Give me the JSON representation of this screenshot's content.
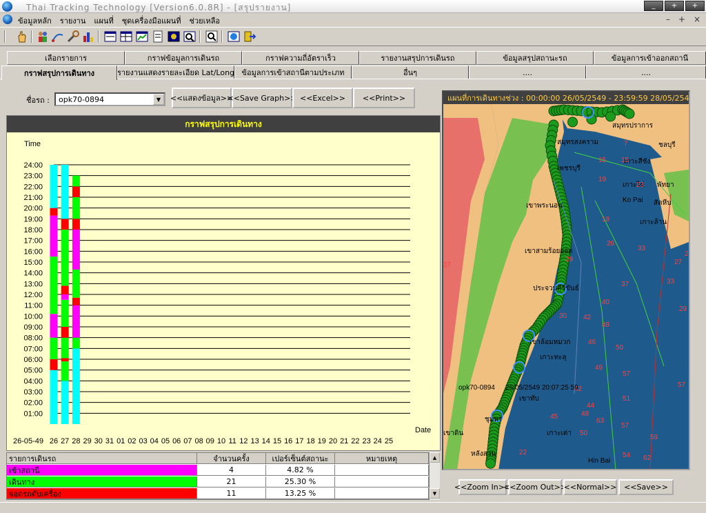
{
  "window": {
    "title": "Thai Tracking Technology [Version6.0.8R] - [สรุปรายงาน]",
    "ctrl_min": "_",
    "ctrl_max": "+",
    "ctrl_close": "+"
  },
  "menu": {
    "items": [
      "ข้อมูลหลัก",
      "รายงาน",
      "แผนที่",
      "ชุดเครื่องมือแผนที่",
      "ช่วยเหลือ"
    ],
    "mdi_min": "–",
    "mdi_restore": "+",
    "mdi_close": "×"
  },
  "tabs_top": [
    "เลือกรายการ",
    "กราฟข้อมูลการเดินรถ",
    "กราฟความถี่อัตราเร็ว",
    "รายงานสรุปการเดินรถ",
    "ข้อมูลสรุปสถานะรถ",
    "ข้อมูลการเข้าออกสถานี"
  ],
  "tabs_bottom": [
    "กราฟสรุปการเดินทาง",
    "รายงานแสดงรายละเอียด Lat/Long",
    "ข้อมูลการเข้าสถานีตามประเภท",
    "อื่นๆ",
    "....",
    "...."
  ],
  "controls": {
    "car_label": "ชื่อรถ :",
    "car_value": "opk70-0894",
    "btn_show": "<<แสดงข้อมูล>>",
    "btn_save_graph": "<<Save Graph>>",
    "btn_excel": "<<Excel>>",
    "btn_print": "<<Print>>"
  },
  "chart_data": {
    "type": "bar",
    "title": "กราฟสรุปการเดินทาง",
    "ylabel": "Time",
    "xlabel": "Date",
    "start_label": "26-05-49",
    "y_ticks": [
      "01:00",
      "02:00",
      "03:00",
      "04:00",
      "05:00",
      "06:00",
      "07:00",
      "08:00",
      "09:00",
      "10:00",
      "11:00",
      "12:00",
      "13:00",
      "14:00",
      "15:00",
      "16:00",
      "17:00",
      "18:00",
      "19:00",
      "20:00",
      "21:00",
      "22:00",
      "23:00",
      "24:00"
    ],
    "x_ticks": [
      "26",
      "27",
      "28",
      "29",
      "30",
      "31",
      "01",
      "02",
      "03",
      "04",
      "05",
      "06",
      "07",
      "08",
      "09",
      "10",
      "11",
      "12",
      "13",
      "14",
      "15",
      "16",
      "17",
      "18",
      "19",
      "20",
      "21",
      "22",
      "23",
      "24",
      "25"
    ],
    "ylim": [
      0,
      24
    ],
    "colors": {
      "station": "#ff00ff",
      "driving": "#00ff00",
      "engine_off": "#ff0000",
      "other": "#00ffff",
      "mark": "#404040"
    },
    "days": [
      {
        "x": "26",
        "segments": [
          {
            "from": 0,
            "to": 5.0,
            "state": "other"
          },
          {
            "from": 5.0,
            "to": 6.0,
            "state": "engine_off"
          },
          {
            "from": 6.0,
            "to": 8.0,
            "state": "driving"
          },
          {
            "from": 8.0,
            "to": 10.2,
            "state": "station"
          },
          {
            "from": 10.2,
            "to": 15.5,
            "state": "driving"
          },
          {
            "from": 15.5,
            "to": 19.3,
            "state": "station"
          },
          {
            "from": 19.3,
            "to": 20.0,
            "state": "engine_off"
          },
          {
            "from": 20.0,
            "to": 24,
            "state": "other"
          }
        ]
      },
      {
        "x": "27",
        "segments": [
          {
            "from": 0,
            "to": 4.0,
            "state": "other"
          },
          {
            "from": 4.0,
            "to": 5.8,
            "state": "driving"
          },
          {
            "from": 5.8,
            "to": 6.1,
            "state": "engine_off"
          },
          {
            "from": 6.1,
            "to": 8.0,
            "state": "driving"
          },
          {
            "from": 8.0,
            "to": 9.0,
            "state": "engine_off"
          },
          {
            "from": 9.0,
            "to": 11.5,
            "state": "driving"
          },
          {
            "from": 11.5,
            "to": 12.0,
            "state": "station"
          },
          {
            "from": 12.0,
            "to": 12.8,
            "state": "engine_off"
          },
          {
            "from": 12.8,
            "to": 18.0,
            "state": "driving"
          },
          {
            "from": 18.0,
            "to": 19.0,
            "state": "engine_off"
          },
          {
            "from": 19.0,
            "to": 24,
            "state": "other"
          }
        ]
      },
      {
        "x": "28",
        "segments": [
          {
            "from": 0,
            "to": 7.0,
            "state": "other"
          },
          {
            "from": 7.0,
            "to": 8.0,
            "state": "driving"
          },
          {
            "from": 8.0,
            "to": 11.0,
            "state": "station"
          },
          {
            "from": 11.0,
            "to": 11.7,
            "state": "engine_off"
          },
          {
            "from": 11.7,
            "to": 14.3,
            "state": "driving"
          },
          {
            "from": 14.3,
            "to": 18.0,
            "state": "station"
          },
          {
            "from": 18.0,
            "to": 19.0,
            "state": "engine_off"
          },
          {
            "from": 19.0,
            "to": 21.0,
            "state": "driving"
          },
          {
            "from": 21.0,
            "to": 22.0,
            "state": "engine_off"
          },
          {
            "from": 22.0,
            "to": 23.0,
            "state": "driving"
          }
        ]
      }
    ]
  },
  "summary_table": {
    "headers": [
      "รายการเดินรถ",
      "จำนวนครั้ง",
      "เปอร์เซ็นต์สถานะ",
      "หมายเหตุ"
    ],
    "rows": [
      {
        "label": "เข้าสถานี",
        "count": "4",
        "percent": "4.82 %",
        "note": "",
        "color": "#ff00ff"
      },
      {
        "label": "เดินทาง",
        "count": "21",
        "percent": "25.30 %",
        "note": "",
        "color": "#00ff00"
      },
      {
        "label": "จอดรถดับเครื่อง",
        "count": "11",
        "percent": "13.25 %",
        "note": "",
        "color": "#ff0000"
      }
    ]
  },
  "map": {
    "header": "แผนที่การเดินทางช่วง : 00:00:00 26/05/2549 - 23:59:59 28/05/2549",
    "vehicle_label": "opk70-0894",
    "vehicle_time": "26/05/2549 20:07:25 59",
    "places": [
      "สมุทรปราการ",
      "สมุทรสงคราม",
      "ชลบุรี",
      "เพชรบุรี",
      "เกาะสีชัง",
      "เกาะไผ่",
      "Ko Pai",
      "พัทยา",
      "สัตหีบ",
      "เกาะล้าน",
      "เขาพระนอน",
      "เพชรบุรี",
      "เขาสามร้อยยอด",
      "ประจวบคีรีขันธ์",
      "เขาล้อมหมวก",
      "เกาะทะลุ",
      "เขาทับ",
      "เขาชมพู",
      "ชุมพร",
      "เกาะเต่า",
      "Hin Bai",
      "หลังสวน",
      "เขาดิน"
    ],
    "depths": [
      "7",
      "15",
      "15",
      "19",
      "23",
      "18",
      "26",
      "33",
      "27",
      "29",
      "37",
      "33",
      "30",
      "40",
      "48",
      "42",
      "46",
      "50",
      "49",
      "57",
      "42",
      "44",
      "48",
      "57",
      "51",
      "45",
      "63",
      "57",
      "59",
      "50",
      "54",
      "62",
      "22",
      "27",
      "21",
      "29"
    ]
  },
  "map_buttons": {
    "zoom_in": "<<Zoom In>>",
    "zoom_out": "<<Zoom Out>>",
    "normal": "<<Normal>>",
    "save": "<<Save>>"
  }
}
